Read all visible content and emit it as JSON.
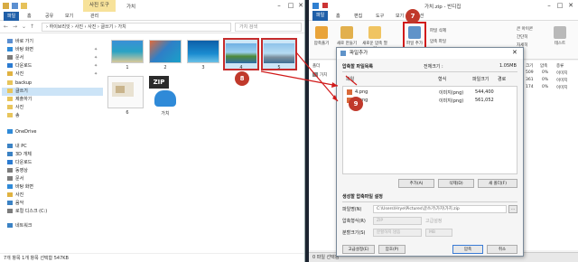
{
  "explorer": {
    "tab_tools": "사진 도구",
    "window_title": "가치",
    "ribbon_tabs": [
      "파일",
      "홈",
      "공유",
      "보기",
      "관리"
    ],
    "address": "› 하이브리잇 › 사진 › 사진 › 글쓰기 › 가치",
    "search_placeholder": "가치 검색",
    "nav_items": [
      {
        "label": "바로 가기",
        "pinned": false
      },
      {
        "label": "바탕 화면",
        "pinned": true
      },
      {
        "label": "문서",
        "pinned": true
      },
      {
        "label": "다운로드",
        "pinned": true
      },
      {
        "label": "사진",
        "pinned": true
      },
      {
        "label": "backup",
        "pinned": false
      },
      {
        "label": "글쓰기",
        "pinned": false
      },
      {
        "label": "제출하기",
        "pinned": false
      },
      {
        "label": "사진",
        "pinned": false
      },
      {
        "label": "송",
        "pinned": false
      },
      {
        "label": "OneDrive",
        "pinned": false
      },
      {
        "label": "내 PC",
        "pinned": false
      },
      {
        "label": "3D 개체",
        "pinned": false
      },
      {
        "label": "다운로드",
        "pinned": false
      },
      {
        "label": "동영상",
        "pinned": false
      },
      {
        "label": "문서",
        "pinned": false
      },
      {
        "label": "바탕 화면",
        "pinned": false
      },
      {
        "label": "사진",
        "pinned": false
      },
      {
        "label": "음악",
        "pinned": false
      },
      {
        "label": "로컬 디스크 (C:)",
        "pinned": false
      },
      {
        "label": "네트워크",
        "pinned": false
      }
    ],
    "thumbnails": [
      {
        "label": "1",
        "selected": false
      },
      {
        "label": "2",
        "selected": false
      },
      {
        "label": "3",
        "selected": false
      },
      {
        "label": "4",
        "selected": true
      },
      {
        "label": "5",
        "selected": true
      },
      {
        "label": "6",
        "selected": false
      },
      {
        "label": "가치",
        "selected": false
      }
    ],
    "zip_text": "ZIP",
    "status": "7개 항목   1개 항목 선택함 547KB"
  },
  "bandizip": {
    "window_title": "가치.zip - 반디집",
    "menu": [
      "파일",
      "홈",
      "편집",
      "도구",
      "보기",
      "옵션"
    ],
    "toolbar": {
      "open_archive": "압축풀기",
      "new_archive": "새로 만들기",
      "new_compress": "새로운 압축 열기",
      "add_file": "파일 추가",
      "file_delete": "파일 삭제",
      "compress_folder": "압축 파일",
      "view_large": "큰 아이콘",
      "view_simple": "간단히",
      "view_detail": "자세히",
      "compress_test": "테스트"
    },
    "list_header": [
      "폴더",
      "크기",
      "압축",
      "종류",
      "수정한 날짜"
    ],
    "list_rows": [
      {
        "name": "가치",
        "size": "509",
        "packed": "0%",
        "type": "이미지"
      },
      {
        "name": "",
        "size": "361",
        "packed": "0%",
        "type": "이미지"
      },
      {
        "name": "",
        "size": "174",
        "packed": "0%",
        "type": "이미지"
      }
    ],
    "status": "0 파일 선택됨"
  },
  "dialog": {
    "title": "파일추가",
    "section1": "압축할 파일목록",
    "total_label": "전체크기 :",
    "total_value": "1.05MB",
    "col_file": "파일",
    "col_path": "경로",
    "col_size": "파일크기",
    "col_type": "형식",
    "files": [
      {
        "name": "4.png",
        "type": "이미지(png)",
        "size": "544,400"
      },
      {
        "name": "5.png",
        "type": "이미지(png)",
        "size": "561,052"
      }
    ],
    "btn_add": "추가(A)",
    "btn_remove": "삭제(D)",
    "btn_clear": "새 폴더(F)",
    "section2": "생성할 압축파일 설정",
    "filename_label": "파일명(N)",
    "filename_value": "C:\\Users\\Hrye\\Pictures\\글쓰기\\가치\\가치.zip",
    "format_label": "압축형식(R)",
    "format_value": "ZIP",
    "split_label": "분할크기(S)",
    "split_value": "분할하지 않음",
    "split_unit": "MB",
    "options_link": "고급설정",
    "btn_advanced": "고급설정(E)",
    "btn_help": "암호(P)",
    "btn_ok": "압축",
    "btn_cancel": "취소"
  },
  "annotations": [
    "7",
    "8",
    "9"
  ]
}
